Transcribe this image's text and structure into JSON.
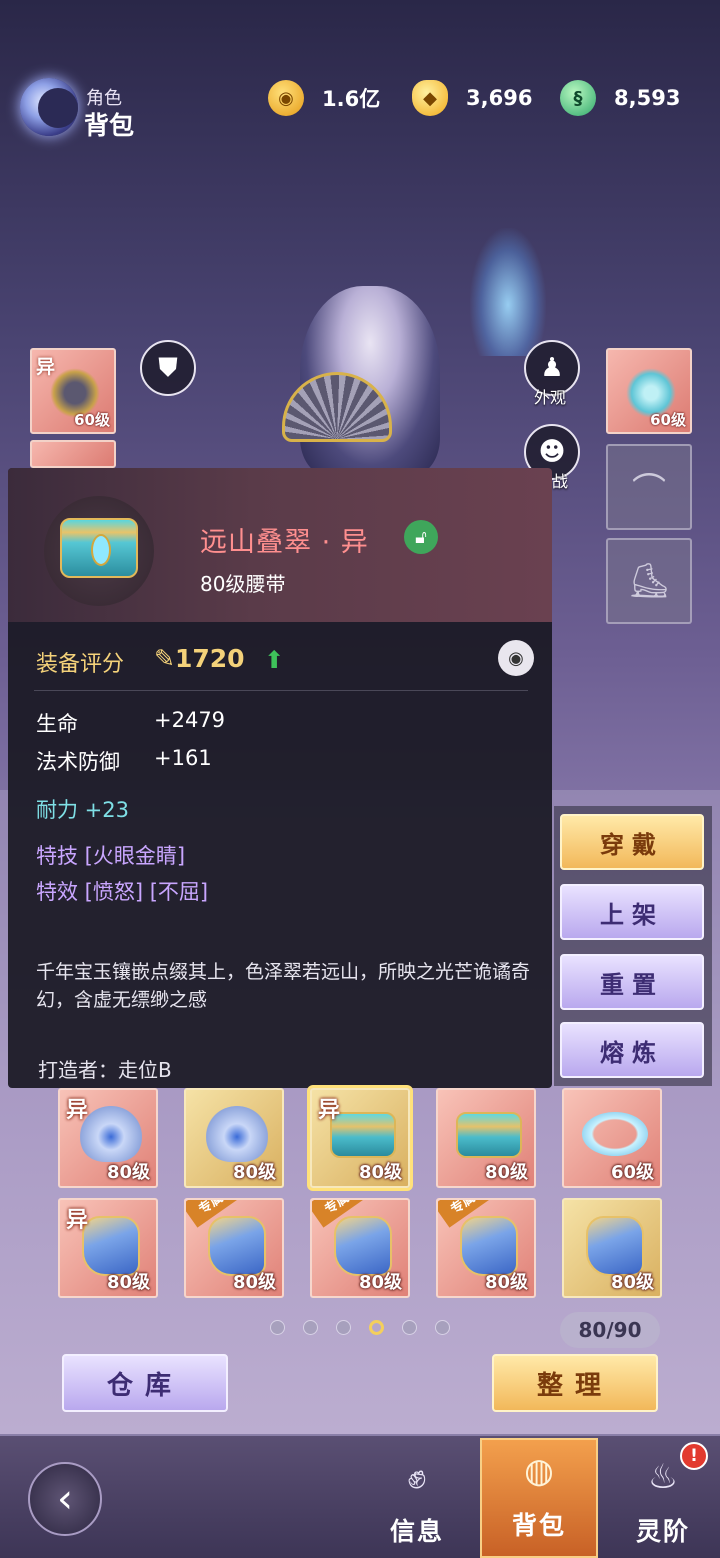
{
  "header": {
    "title_small": "角色",
    "title_big": "背包",
    "currencies": [
      {
        "name": "coin-icon",
        "value": "1.6亿"
      },
      {
        "name": "ingot-icon",
        "value": "3,696"
      },
      {
        "name": "jade-icon",
        "value": "8,593"
      }
    ]
  },
  "scene": {
    "appearance_label": "外观",
    "battle_label": "战",
    "left_slots": [
      {
        "tag": "异",
        "level": "60级"
      }
    ],
    "right_slots": [
      {
        "level": "60级"
      }
    ]
  },
  "tooltip": {
    "item_name": "远山叠翠 · 异",
    "item_sub": "80级腰带",
    "score_label": "装备评分",
    "score_value": "1720",
    "stats": [
      {
        "label": "生命",
        "value": "+2479"
      },
      {
        "label": "法术防御",
        "value": "+161"
      }
    ],
    "endurance": "耐力 +23",
    "skill": "特技 [火眼金睛]",
    "effect": "特效 [愤怒] [不屈]",
    "description": "千年宝玉镶嵌点缀其上，色泽翠若远山，所映之光芒诡谲奇幻，含虚无缥缈之感",
    "maker": "打造者：走位B"
  },
  "actions": {
    "equip": "穿戴",
    "list": "上架",
    "reset": "重置",
    "smelt": "熔炼"
  },
  "grid": {
    "row1": [
      {
        "tag": "异",
        "level": "80级",
        "art": "wing",
        "color": "red"
      },
      {
        "tag": "",
        "level": "80级",
        "art": "wing",
        "color": "gold"
      },
      {
        "tag": "异",
        "level": "80级",
        "art": "belt",
        "color": "gold",
        "selected": true
      },
      {
        "tag": "",
        "level": "80级",
        "art": "belt",
        "color": "red"
      },
      {
        "tag": "",
        "level": "60级",
        "art": "ring",
        "color": "red"
      }
    ],
    "row2": [
      {
        "tag": "异",
        "excl": "",
        "level": "80级",
        "art": "boot",
        "color": "red"
      },
      {
        "tag": "",
        "excl": "专属",
        "level": "80级",
        "art": "boot",
        "color": "red"
      },
      {
        "tag": "",
        "excl": "专属",
        "level": "80级",
        "art": "boot",
        "color": "red"
      },
      {
        "tag": "",
        "excl": "专属",
        "level": "80级",
        "art": "boot",
        "color": "red"
      },
      {
        "tag": "",
        "excl": "",
        "level": "80级",
        "art": "boot",
        "color": "gold"
      }
    ],
    "capacity": "80/90",
    "page_count": 6,
    "active_page": 3
  },
  "buttons": {
    "warehouse": "仓库",
    "sort": "整理"
  },
  "nav": {
    "info": "信息",
    "bag": "背包",
    "spirit": "灵阶",
    "badge": "!"
  },
  "colors": {
    "accent_gold": "#f4d27a",
    "item_name_red": "#ff8f8f",
    "stat_cyan": "#7fe0e6",
    "stat_purple": "#c9a6ff"
  }
}
